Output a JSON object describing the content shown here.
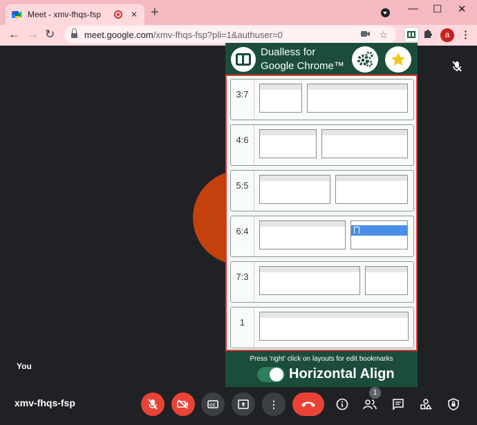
{
  "browser": {
    "tab_title": "Meet - xmv-fhqs-fsp",
    "tab_close": "✕",
    "new_tab": "+",
    "win_min": "—",
    "win_max": "☐",
    "win_close": "✕",
    "url_host": "meet.google.com",
    "url_rest": "/xmv-fhqs-fsp?pli=1&authuser=0",
    "profile_initial": "a",
    "back": "←",
    "forward": "→",
    "reload": "↻"
  },
  "dualless": {
    "title_line1": "Dualless for",
    "title_line2": "Google Chrome™",
    "layouts": [
      {
        "ratio": "3:7"
      },
      {
        "ratio": "4:6"
      },
      {
        "ratio": "5:5"
      },
      {
        "ratio": "6:4"
      },
      {
        "ratio": "7:3"
      },
      {
        "ratio": "1"
      }
    ],
    "hint": "Press 'right' click on layouts for edit bookmarks",
    "toggle_label": "Horizontal Align",
    "toggle_on": true
  },
  "meet": {
    "self_label": "You",
    "meeting_code": "xmv-fhqs-fsp",
    "participants_count": "1",
    "avatar_color": "#c2410c"
  },
  "colors": {
    "tabstrip": "#f4b9c1",
    "toolbar": "#ffd9de",
    "popup": "#1b4d3a",
    "frame_border": "#e53935",
    "control_red": "#ea4335"
  }
}
